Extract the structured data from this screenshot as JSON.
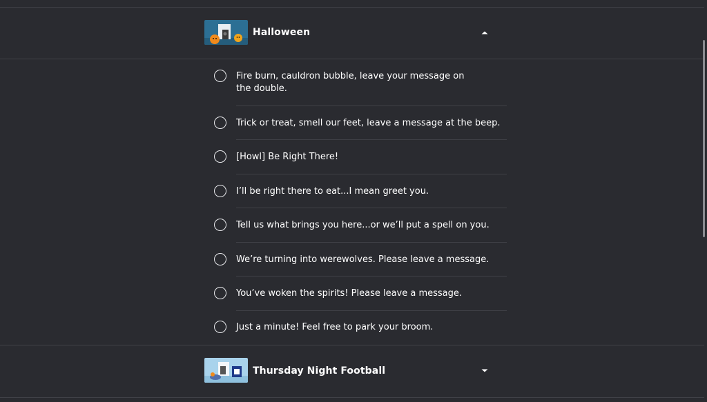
{
  "sections": [
    {
      "title": "Halloween",
      "expanded_icon": "chevron-up-icon",
      "options": [
        "Fire burn, cauldron bubble, leave your message on the double.",
        "Trick or treat, smell our feet, leave a message at the beep.",
        "[Howl] Be Right There!",
        "I’ll be right there to eat...I mean greet you.",
        "Tell us what brings you here...or we’ll put a spell on you.",
        "We’re turning into werewolves. Please leave a message.",
        "You’ve woken the spirits! Please leave a message.",
        "Just a minute! Feel free to park your broom."
      ]
    },
    {
      "title": "Thursday Night Football",
      "expanded_icon": "chevron-down-icon"
    }
  ],
  "colors": {
    "background": "#2a2b30",
    "divider": "#404147",
    "text": "#ffffff",
    "radio_border": "#e8e9ec"
  }
}
